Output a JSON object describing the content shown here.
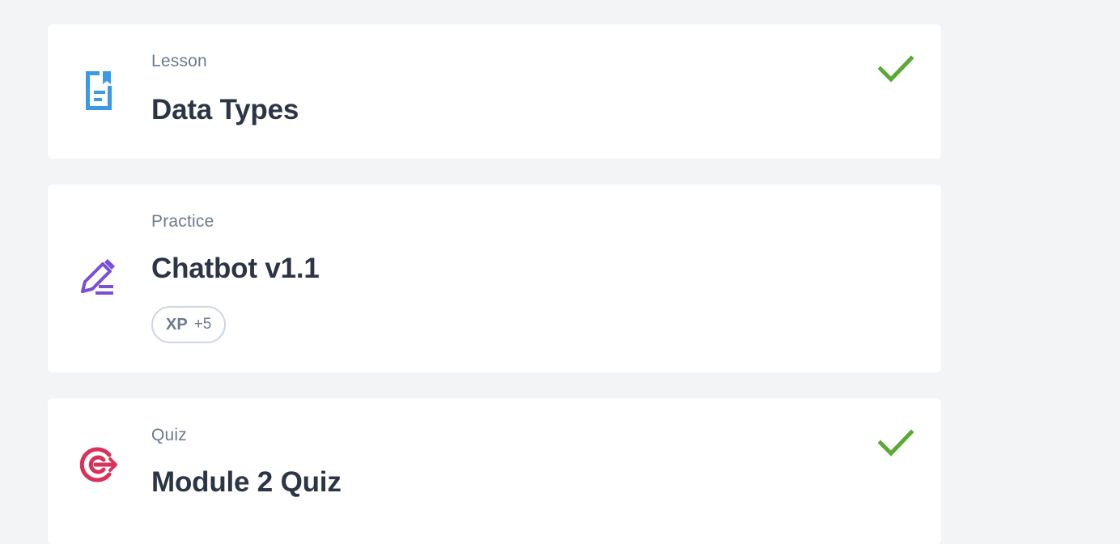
{
  "items": [
    {
      "type_label": "Lesson",
      "title": "Data Types",
      "icon": "lesson-document-icon",
      "icon_color": "#3b9ae6",
      "completed": true
    },
    {
      "type_label": "Practice",
      "title": "Chatbot v1.1",
      "icon": "practice-pencil-icon",
      "icon_color": "#7b4fd6",
      "completed": false,
      "badge": {
        "key": "XP",
        "value": "+5"
      }
    },
    {
      "type_label": "Quiz",
      "title": "Module 2 Quiz",
      "icon": "quiz-target-icon",
      "icon_color": "#d9315a",
      "completed": true
    }
  ],
  "colors": {
    "background": "#f3f4f6",
    "card": "#ffffff",
    "check": "#5aaa35",
    "label": "#6b7a90",
    "title": "#2b3545"
  }
}
